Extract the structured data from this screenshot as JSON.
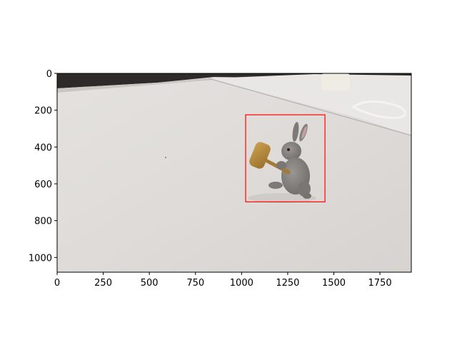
{
  "figure": {
    "image_width": 1920,
    "image_height": 1080,
    "x_ticks": [
      0,
      250,
      500,
      750,
      1000,
      1250,
      1500,
      1750
    ],
    "y_ticks": [
      0,
      200,
      400,
      600,
      800,
      1000
    ],
    "detection_box": {
      "x_min": 1022,
      "y_min": 225,
      "x_max": 1452,
      "y_max": 698,
      "color": "#ff0000"
    }
  },
  "colors": {
    "table": "#dcd9d6",
    "table_light": "#e7e5e3",
    "background_dark": "#2a2a2a",
    "rabbit": "#8a8684",
    "mallet": "#b88a3e"
  }
}
